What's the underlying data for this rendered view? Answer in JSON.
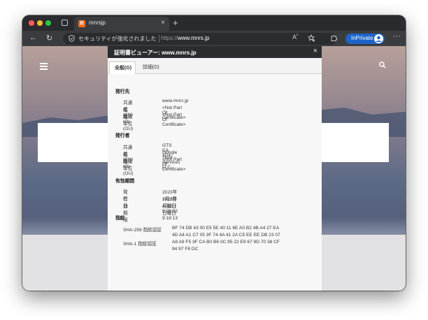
{
  "tab": {
    "favicon": "B",
    "title": "mnrsjp",
    "close": "×"
  },
  "newtab": "+",
  "toolbar": {
    "back": "←",
    "reload": "↻",
    "security_text": "セキュリティが強化されました",
    "url_scheme": "https://",
    "url_host": "www.mnrs.jp",
    "inprivate": "InPrivate",
    "more": "···"
  },
  "dialog": {
    "title": "証明書ビューアー: www.mnrs.jp",
    "close": "×",
    "tabs": [
      "全般(G)",
      "詳細(D)"
    ],
    "issued_to": {
      "heading": "発行先",
      "rows": [
        {
          "label": "共通名 (CN)",
          "value": "www.mnrs.jp"
        },
        {
          "label": "組織 (O)",
          "value": "<Not Part Of Certificate>"
        },
        {
          "label": "組織単位 (OU)",
          "value": "<Not Part Of Certificate>"
        }
      ]
    },
    "issued_by": {
      "heading": "発行者",
      "rows": [
        {
          "label": "共通名 (CN)",
          "value": "GTS CA 1D4"
        },
        {
          "label": "組織 (O)",
          "value": "Google Trust Services LLC"
        },
        {
          "label": "組織単位 (OU)",
          "value": "<Not Part Of Certificate>"
        }
      ]
    },
    "validity": {
      "heading": "有効期間",
      "rows": [
        {
          "label": "発行日",
          "value": "2023年1月2日月曜日 8:28:02"
        },
        {
          "label": "有効期限",
          "value": "2023年4月2日日曜日 9:18:13"
        }
      ]
    },
    "fingerprints": {
      "heading": "指紋",
      "sha256_label": "SHA-256 指紋認証",
      "sha256_line1": "BF 74 DB 43 00 E5 5E 40 11 6E A0 B2 4B A4 27 EA",
      "sha256_line2": "4D A4 A1 C7 05 3F 74 4A 41 2A C5 EE EE DB 23 07",
      "sha1_label": "SHA-1 指紋認証",
      "sha1_line1": "A8 A9 F5 3F CA B0 B6 0C 85 22 E9 67 9D 70 38 CF",
      "sha1_line2": "94 97 F8 DC"
    }
  }
}
